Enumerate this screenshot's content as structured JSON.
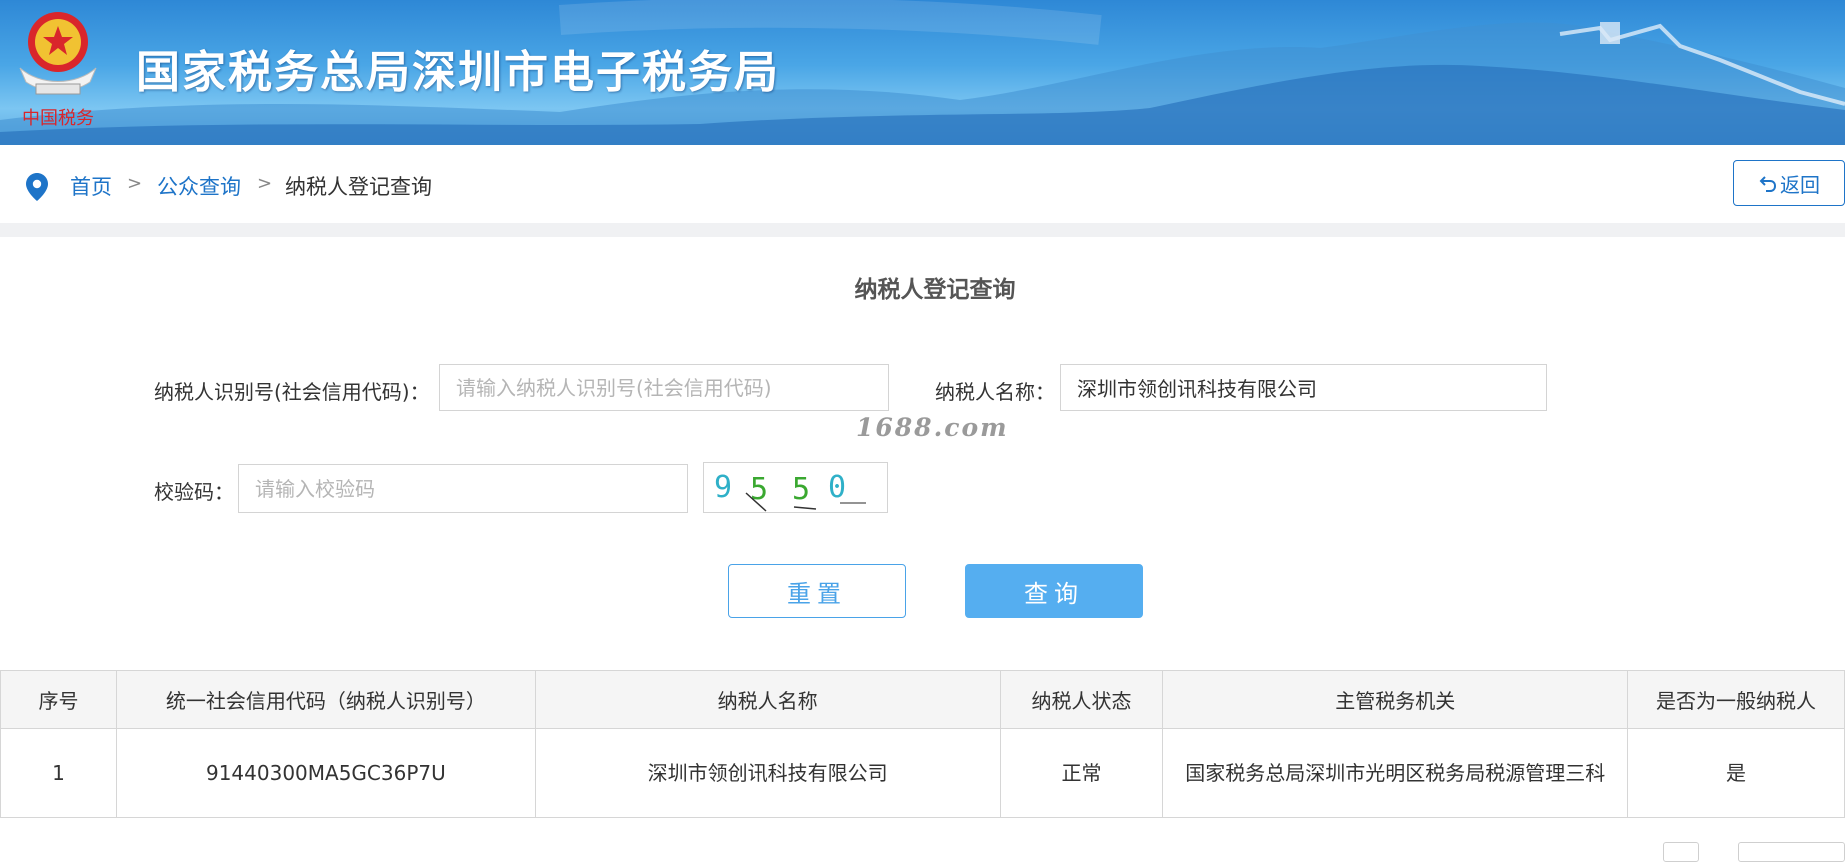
{
  "header": {
    "title": "国家税务总局深圳市电子税务局",
    "emblem_caption": "中国税务",
    "colors": {
      "banner_top": "#2e88d6",
      "banner_bottom": "#7cc6f2"
    }
  },
  "breadcrumb": {
    "home": "首页",
    "section": "公众查询",
    "current": "纳税人登记查询",
    "separator": ">"
  },
  "back_button": {
    "label": "返回"
  },
  "form": {
    "title": "纳税人登记查询",
    "taxpayer_id": {
      "label": "纳税人识别号(社会信用代码)：",
      "placeholder": "请输入纳税人识别号(社会信用代码)",
      "value": ""
    },
    "taxpayer_name": {
      "label": "纳税人名称：",
      "value": "深圳市领创讯科技有限公司"
    },
    "verify_code": {
      "label": "校验码：",
      "placeholder": "请输入校验码",
      "value": ""
    },
    "captcha_text": [
      "9",
      "5",
      "5",
      "0"
    ],
    "watermark": "1688.com",
    "reset_label": "重置",
    "query_label": "查询"
  },
  "table": {
    "columns": [
      "序号",
      "统一社会信用代码（纳税人识别号）",
      "纳税人名称",
      "纳税人状态",
      "主管税务机关",
      "是否为一般纳税人"
    ],
    "rows": [
      {
        "index": "1",
        "credit_code": "91440300MA5GC36P7U",
        "name": "深圳市领创讯科技有限公司",
        "status": "正常",
        "authority": "国家税务总局深圳市光明区税务局税源管理三科",
        "general_taxpayer": "是"
      }
    ]
  },
  "accent_colors": {
    "link": "#1e74c8",
    "primary_button": "#55aef0"
  }
}
